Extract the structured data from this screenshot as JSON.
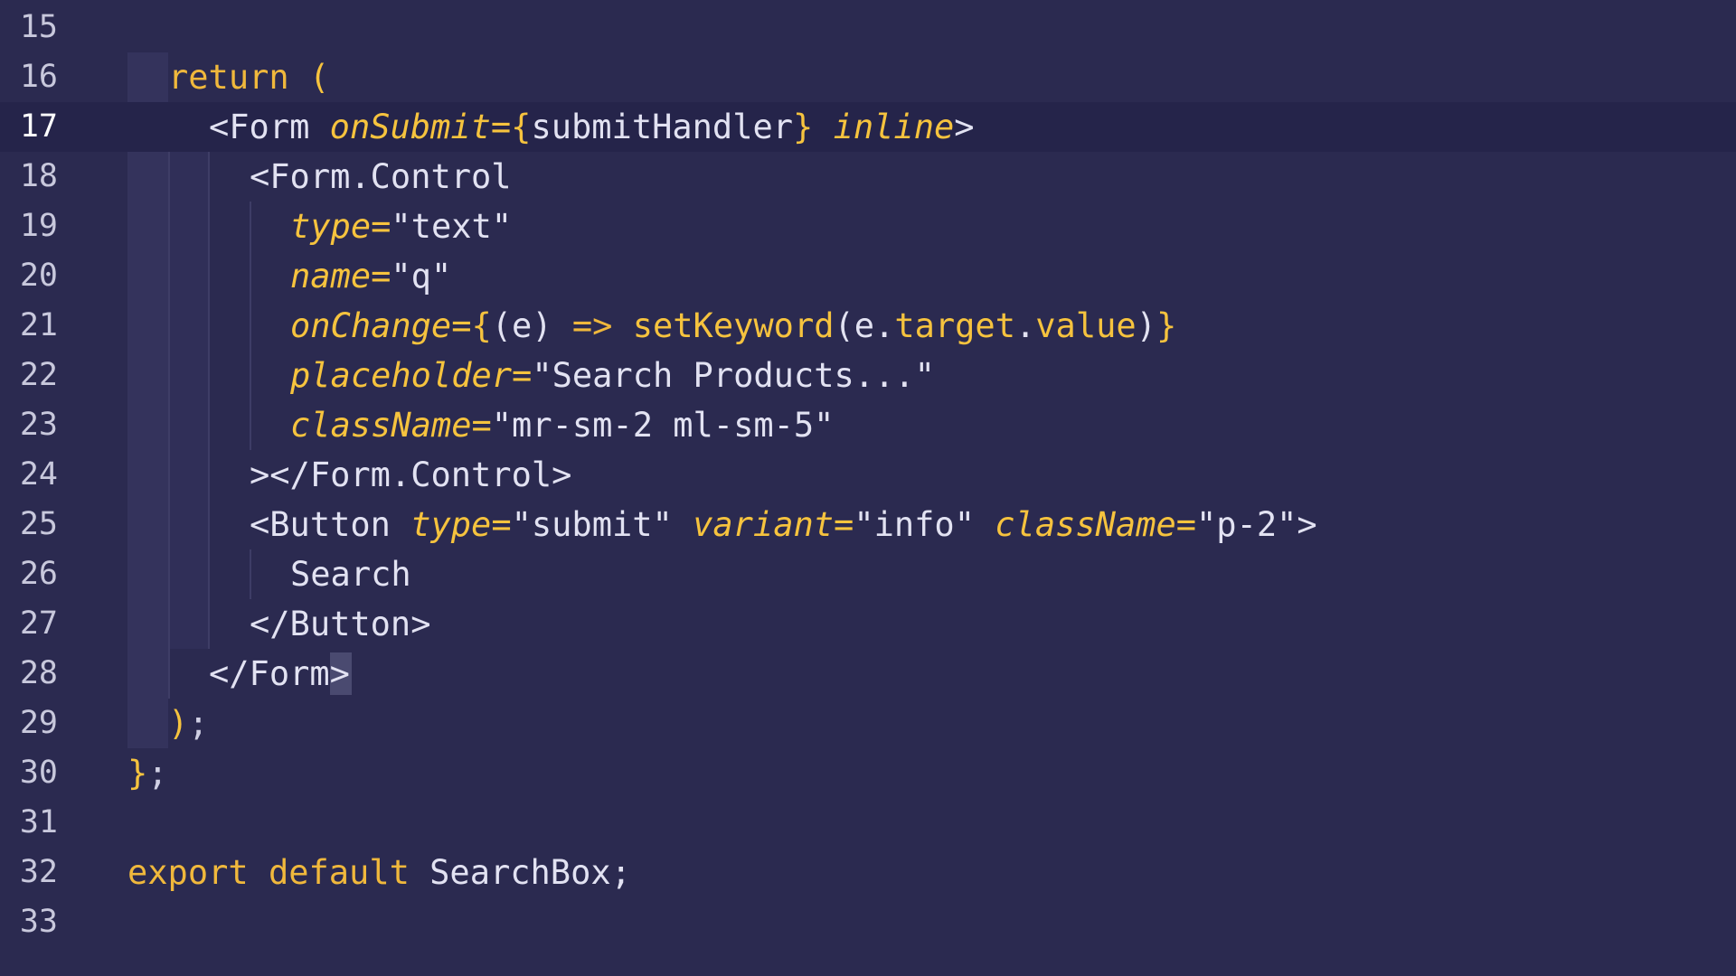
{
  "editor": {
    "colors": {
      "background": "#2b2a50",
      "current_line": "#25244a",
      "keyword": "#f0b83c",
      "attribute": "#f6c33e",
      "text": "#e2e2f2"
    },
    "current_line_number": "17",
    "lines": [
      {
        "num": "15",
        "tokens": []
      },
      {
        "num": "16",
        "tokens": [
          {
            "t": "kw",
            "v": "return"
          },
          {
            "t": "plain",
            "v": " "
          },
          {
            "t": "brace",
            "v": "("
          }
        ]
      },
      {
        "num": "17",
        "tokens": [
          {
            "t": "tag",
            "v": "<Form"
          },
          {
            "t": "plain",
            "v": " "
          },
          {
            "t": "attr",
            "v": "onSubmit"
          },
          {
            "t": "attr",
            "v": "="
          },
          {
            "t": "brace",
            "v": "{"
          },
          {
            "t": "plain",
            "v": "submitHandler"
          },
          {
            "t": "brace",
            "v": "}"
          },
          {
            "t": "plain",
            "v": " "
          },
          {
            "t": "attr",
            "v": "inline"
          },
          {
            "t": "tag",
            "v": ">"
          }
        ]
      },
      {
        "num": "18",
        "tokens": [
          {
            "t": "tag",
            "v": "<Form.Control"
          }
        ]
      },
      {
        "num": "19",
        "tokens": [
          {
            "t": "attr",
            "v": "type"
          },
          {
            "t": "attr",
            "v": "="
          },
          {
            "t": "str",
            "v": "\"text\""
          }
        ]
      },
      {
        "num": "20",
        "tokens": [
          {
            "t": "attr",
            "v": "name"
          },
          {
            "t": "attr",
            "v": "="
          },
          {
            "t": "str",
            "v": "\"q\""
          }
        ]
      },
      {
        "num": "21",
        "tokens": [
          {
            "t": "attr",
            "v": "onChange"
          },
          {
            "t": "attr",
            "v": "="
          },
          {
            "t": "brace",
            "v": "{"
          },
          {
            "t": "plain",
            "v": "(e) "
          },
          {
            "t": "kw",
            "v": "=>"
          },
          {
            "t": "plain",
            "v": " "
          },
          {
            "t": "fn",
            "v": "setKeyword"
          },
          {
            "t": "plain",
            "v": "(e."
          },
          {
            "t": "fn",
            "v": "target"
          },
          {
            "t": "plain",
            "v": "."
          },
          {
            "t": "fn",
            "v": "value"
          },
          {
            "t": "plain",
            "v": ")"
          },
          {
            "t": "brace",
            "v": "}"
          }
        ]
      },
      {
        "num": "22",
        "tokens": [
          {
            "t": "attr",
            "v": "placeholder"
          },
          {
            "t": "attr",
            "v": "="
          },
          {
            "t": "str",
            "v": "\"Search Products...\""
          }
        ]
      },
      {
        "num": "23",
        "tokens": [
          {
            "t": "attr",
            "v": "className"
          },
          {
            "t": "attr",
            "v": "="
          },
          {
            "t": "str",
            "v": "\"mr-sm-2 ml-sm-5\""
          }
        ]
      },
      {
        "num": "24",
        "tokens": [
          {
            "t": "tag",
            "v": "></Form.Control>"
          }
        ]
      },
      {
        "num": "25",
        "tokens": [
          {
            "t": "tag",
            "v": "<Button"
          },
          {
            "t": "plain",
            "v": " "
          },
          {
            "t": "attr",
            "v": "type"
          },
          {
            "t": "attr",
            "v": "="
          },
          {
            "t": "str",
            "v": "\"submit\""
          },
          {
            "t": "plain",
            "v": " "
          },
          {
            "t": "attr",
            "v": "variant"
          },
          {
            "t": "attr",
            "v": "="
          },
          {
            "t": "str",
            "v": "\"info\""
          },
          {
            "t": "plain",
            "v": " "
          },
          {
            "t": "attr",
            "v": "className"
          },
          {
            "t": "attr",
            "v": "="
          },
          {
            "t": "str",
            "v": "\"p-2\""
          },
          {
            "t": "tag",
            "v": ">"
          }
        ]
      },
      {
        "num": "26",
        "tokens": [
          {
            "t": "plain",
            "v": "Search"
          }
        ]
      },
      {
        "num": "27",
        "tokens": [
          {
            "t": "tag",
            "v": "</Button>"
          }
        ]
      },
      {
        "num": "28",
        "tokens": [
          {
            "t": "tag",
            "v": "</Form>"
          }
        ]
      },
      {
        "num": "29",
        "tokens": [
          {
            "t": "brace",
            "v": ")"
          },
          {
            "t": "muted",
            "v": ";"
          }
        ]
      },
      {
        "num": "30",
        "tokens": [
          {
            "t": "brace",
            "v": "}"
          },
          {
            "t": "muted",
            "v": ";"
          }
        ]
      },
      {
        "num": "31",
        "tokens": []
      },
      {
        "num": "32",
        "tokens": [
          {
            "t": "kw",
            "v": "export"
          },
          {
            "t": "plain",
            "v": " "
          },
          {
            "t": "kw",
            "v": "default"
          },
          {
            "t": "plain",
            "v": " SearchBox;"
          }
        ]
      },
      {
        "num": "33",
        "tokens": []
      }
    ]
  }
}
